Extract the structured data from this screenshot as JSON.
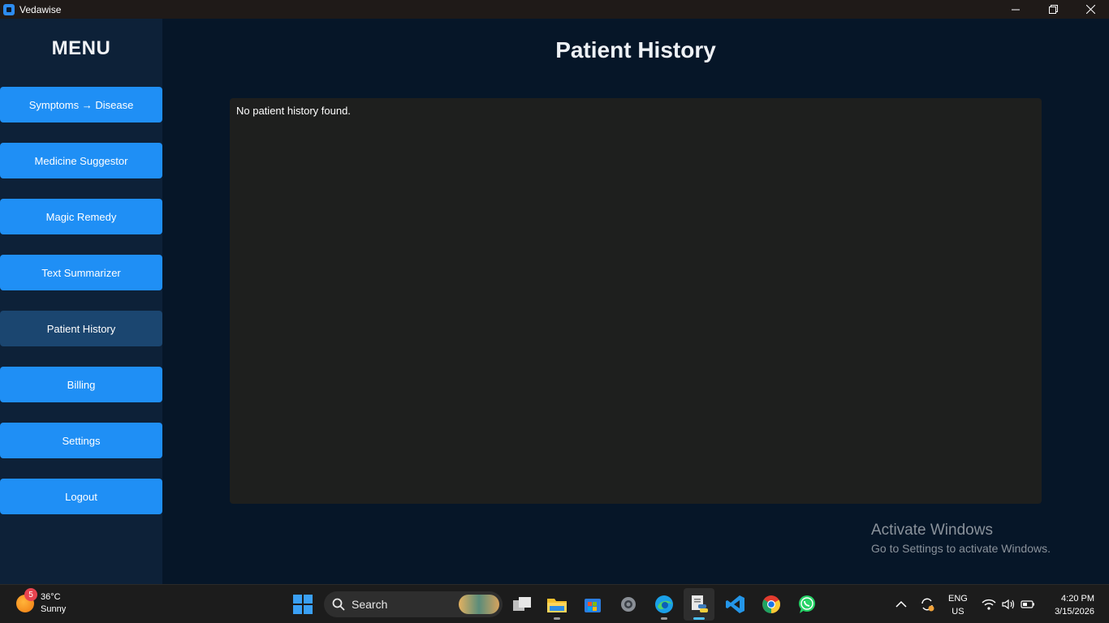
{
  "window": {
    "title": "Vedawise"
  },
  "sidebar": {
    "title": "MENU",
    "items": [
      {
        "label": "Symptoms → Disease"
      },
      {
        "label": "Medicine Suggestor"
      },
      {
        "label": "Magic Remedy"
      },
      {
        "label": "Text Summarizer"
      },
      {
        "label": "Patient History",
        "active": true
      },
      {
        "label": "Billing"
      },
      {
        "label": "Settings"
      },
      {
        "label": "Logout"
      }
    ]
  },
  "main": {
    "title": "Patient History",
    "history_text": "No patient history found."
  },
  "watermark": {
    "line1": "Activate Windows",
    "line2": "Go to Settings to activate Windows."
  },
  "taskbar": {
    "weather": {
      "badge": "5",
      "temp": "36°C",
      "condition": "Sunny"
    },
    "search_label": "Search",
    "language": {
      "line1": "ENG",
      "line2": "US"
    },
    "clock": {
      "time": "4:20 PM",
      "date": "3/15/2026"
    }
  },
  "colors": {
    "accent": "#1f8ff5",
    "active_item": "#1b4670",
    "background": "#061628",
    "sidebar": "#0d2138",
    "panel": "#1e1f1e"
  }
}
